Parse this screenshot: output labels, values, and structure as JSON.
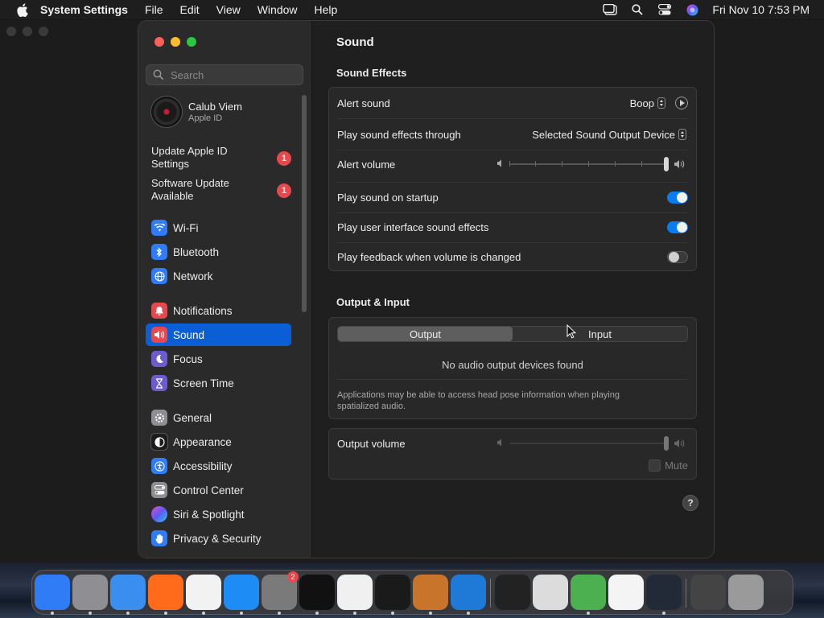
{
  "menubar": {
    "app_name": "System Settings",
    "menus": [
      "File",
      "Edit",
      "View",
      "Window",
      "Help"
    ],
    "clock": "Fri Nov 10  7:53 PM"
  },
  "sidebar": {
    "search_placeholder": "Search",
    "account": {
      "name": "Calub Viem",
      "subtitle": "Apple ID"
    },
    "notices": [
      {
        "label": "Update Apple ID Settings",
        "badge": "1"
      },
      {
        "label": "Software Update Available",
        "badge": "1"
      }
    ],
    "items": [
      {
        "label": "Wi-Fi",
        "color": "#2f7cf6"
      },
      {
        "label": "Bluetooth",
        "color": "#2f7cf6"
      },
      {
        "label": "Network",
        "color": "#2f7cf6"
      },
      {
        "label": "Notifications",
        "color": "#e5484d"
      },
      {
        "label": "Sound",
        "color": "#e5484d"
      },
      {
        "label": "Focus",
        "color": "#6d5bd0"
      },
      {
        "label": "Screen Time",
        "color": "#6d5bd0"
      },
      {
        "label": "General",
        "color": "#8e8e93"
      },
      {
        "label": "Appearance",
        "color": "#1c1c1c"
      },
      {
        "label": "Accessibility",
        "color": "#2f7cf6"
      },
      {
        "label": "Control Center",
        "color": "#8e8e93"
      },
      {
        "label": "Siri & Spotlight",
        "color": "#b44ad8"
      },
      {
        "label": "Privacy & Security",
        "color": "#2f7cf6"
      }
    ],
    "selected": "Sound"
  },
  "content": {
    "title": "Sound",
    "sound_effects": {
      "heading": "Sound Effects",
      "alert_sound_label": "Alert sound",
      "alert_sound_value": "Boop",
      "output_through_label": "Play sound effects through",
      "output_through_value": "Selected Sound Output Device",
      "alert_volume_label": "Alert volume",
      "alert_volume": 1.0,
      "startup_label": "Play sound on startup",
      "startup_on": true,
      "ui_sounds_label": "Play user interface sound effects",
      "ui_sounds_on": true,
      "feedback_label": "Play feedback when volume is changed",
      "feedback_on": false
    },
    "output_input": {
      "heading": "Output & Input",
      "tabs": [
        "Output",
        "Input"
      ],
      "selected_tab": "Output",
      "empty_message": "No audio output devices found",
      "note": "Applications may be able to access head pose information when playing spatialized audio."
    },
    "output_volume": {
      "label": "Output volume",
      "level": 1.0,
      "mute_label": "Mute"
    },
    "help_label": "?"
  },
  "dock": {
    "apps": [
      {
        "name": "Finder",
        "color": "#2f7cf6"
      },
      {
        "name": "Launchpad",
        "color": "#8e8e93"
      },
      {
        "name": "Safari",
        "color": "#3a8ef0"
      },
      {
        "name": "Firefox",
        "color": "#ff6b1a"
      },
      {
        "name": "Chrome",
        "color": "#f2f2f2"
      },
      {
        "name": "App Store",
        "color": "#1e8cf5"
      },
      {
        "name": "System Settings",
        "color": "#7a7a7a",
        "badge": "2"
      },
      {
        "name": "TikTok",
        "color": "#111111"
      },
      {
        "name": "TextEdit",
        "color": "#f0f0f0"
      },
      {
        "name": "Terminal",
        "color": "#1a1a1a"
      },
      {
        "name": "GarageBand",
        "color": "#c8742a"
      },
      {
        "name": "VS Code",
        "color": "#1e7ad6"
      },
      {
        "name": "Piano",
        "color": "#222222"
      },
      {
        "name": "Script Editor",
        "color": "#dcdcdc"
      },
      {
        "name": "Maps",
        "color": "#4caf50"
      },
      {
        "name": "Freeform",
        "color": "#f4f4f4"
      },
      {
        "name": "Stocks",
        "color": "#222a38"
      },
      {
        "name": "Downloads",
        "color": "#444444"
      },
      {
        "name": "Trash",
        "color": "#9a9a9a"
      }
    ]
  }
}
